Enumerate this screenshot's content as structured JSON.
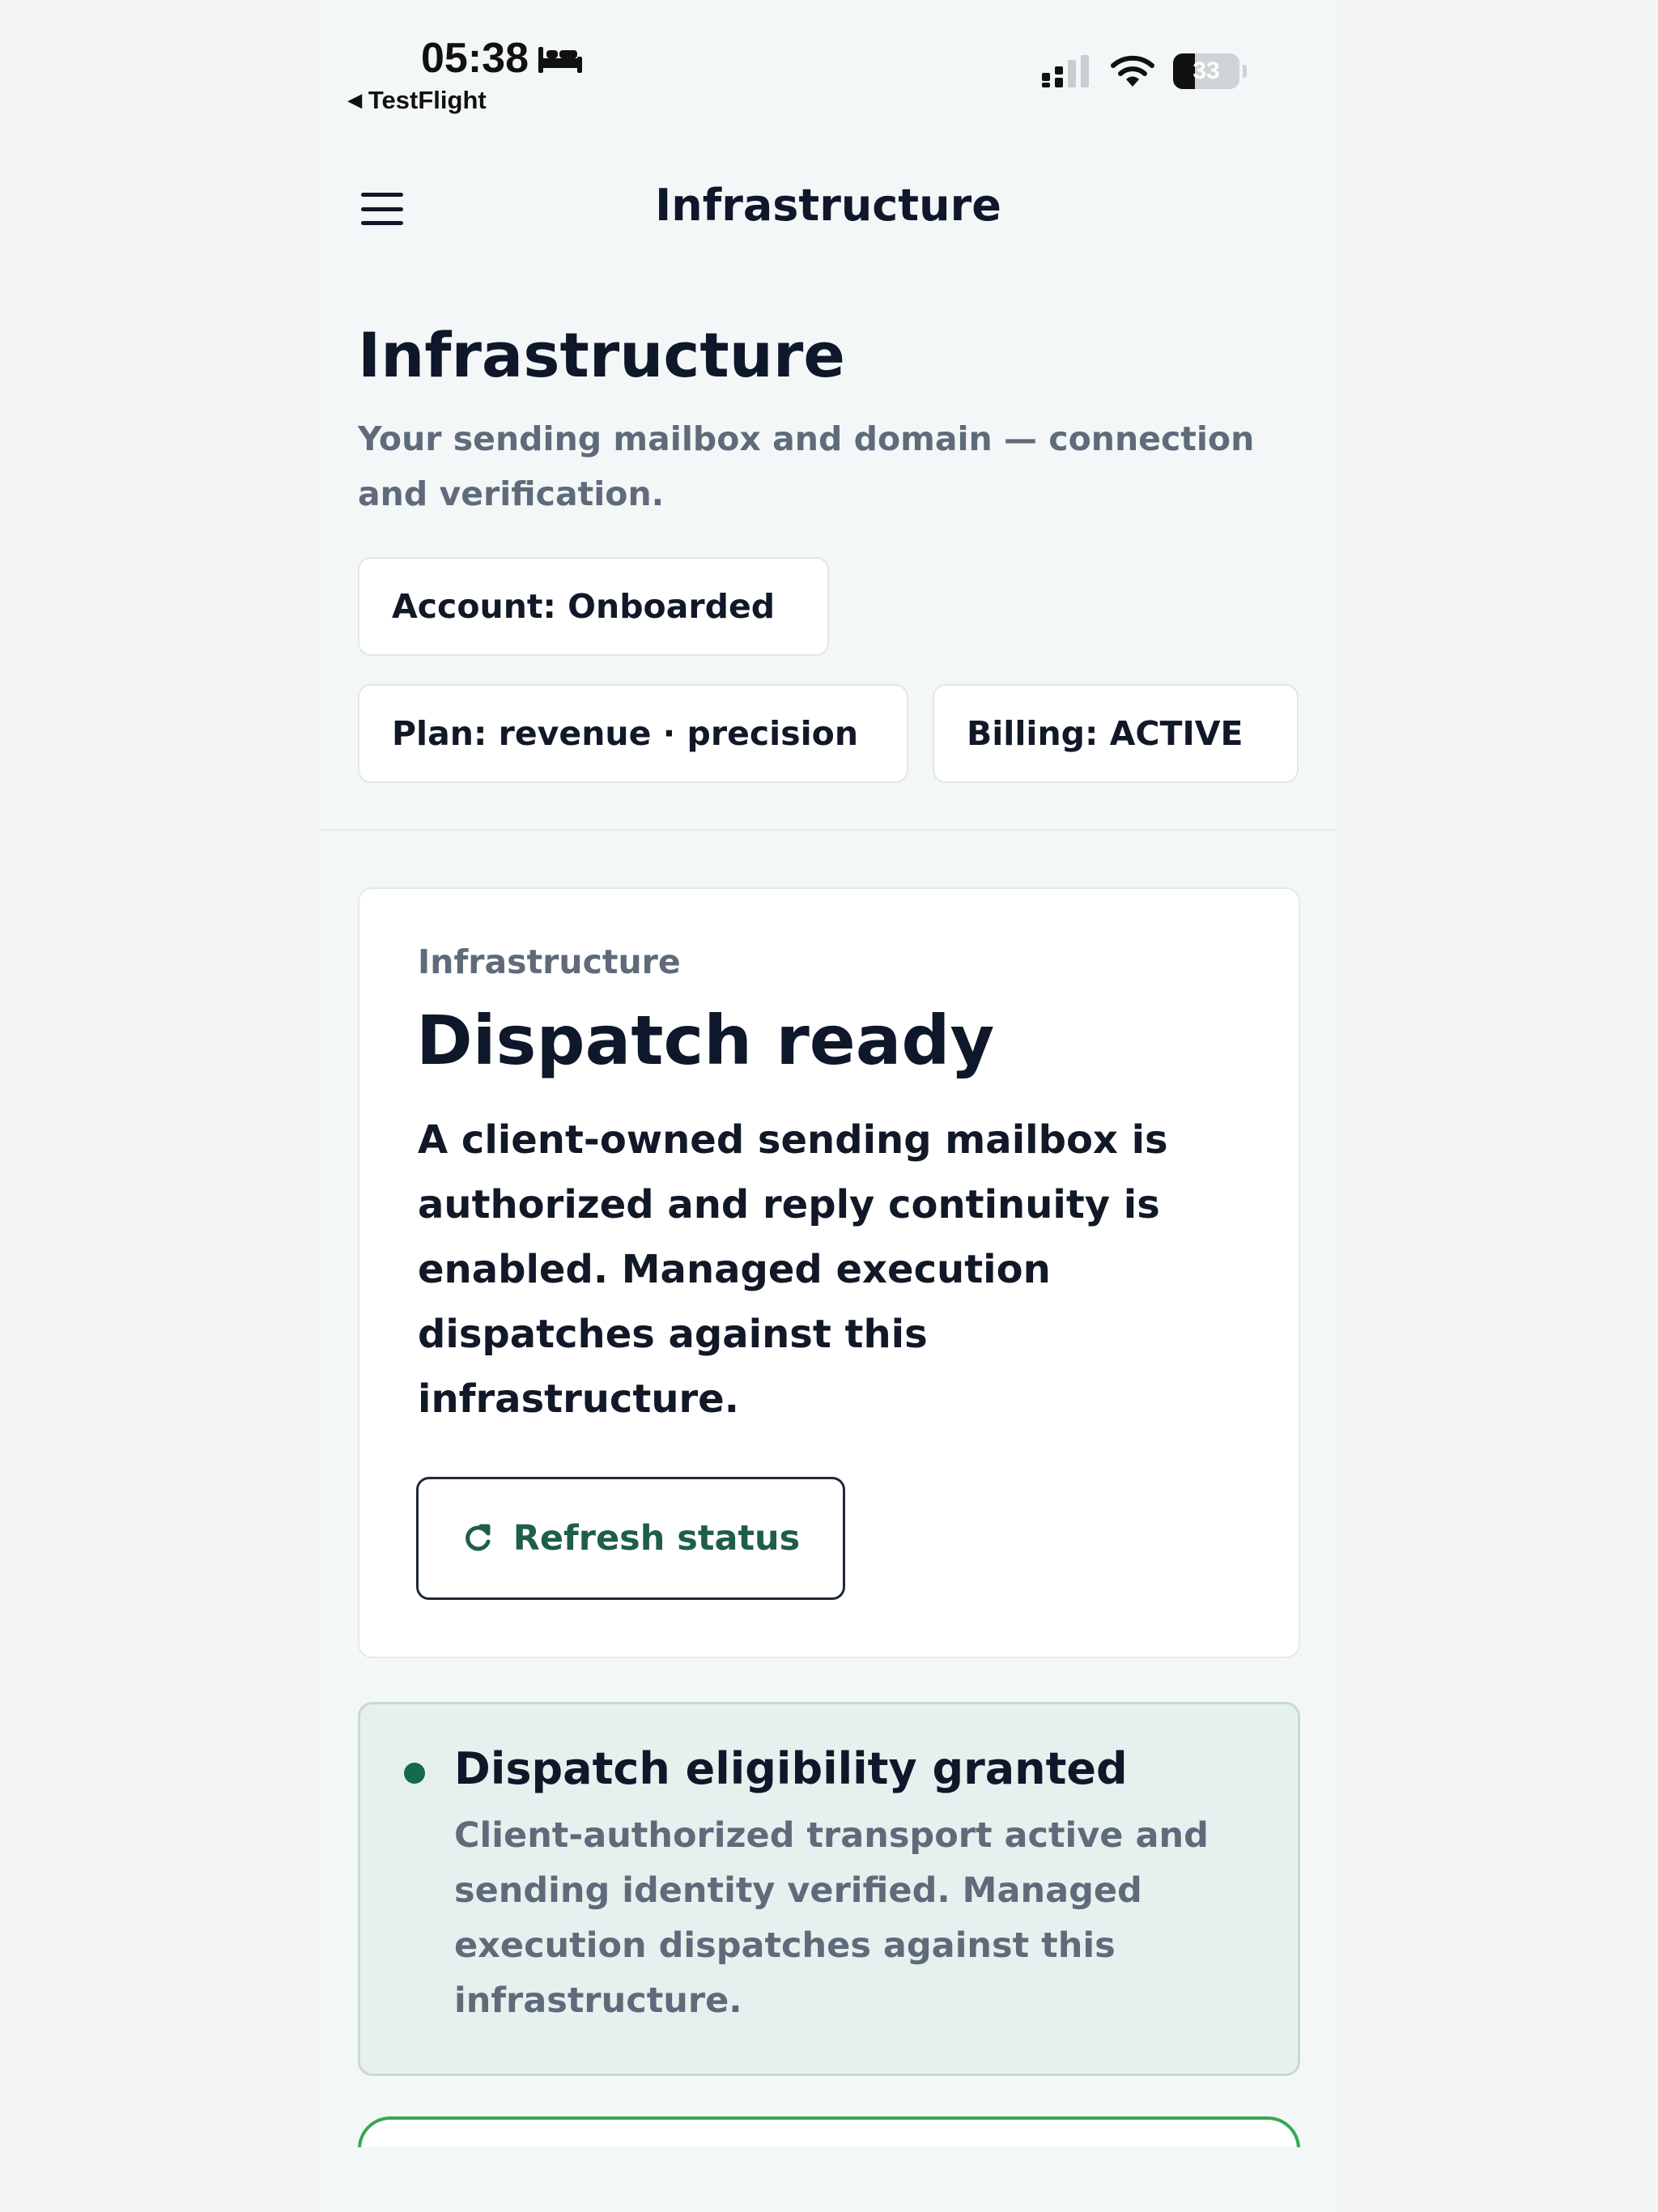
{
  "status_bar": {
    "time": "05:38",
    "back_app": "TestFlight",
    "battery_level": "33"
  },
  "header": {
    "title": "Infrastructure"
  },
  "page": {
    "title": "Infrastructure",
    "subtitle": "Your sending mailbox and domain — connection and verification."
  },
  "chips": {
    "account": "Account: Onboarded",
    "plan": "Plan: revenue · precision",
    "billing": "Billing: ACTIVE"
  },
  "status_card": {
    "eyebrow": "Infrastructure",
    "heading": "Dispatch ready",
    "body": "A client-owned sending mailbox is authorized and reply continuity is enabled. Managed execution dispatches against this infrastructure.",
    "refresh_label": "Refresh status"
  },
  "eligibility": {
    "title": "Dispatch eligibility granted",
    "body": "Client-authorized transport active and sending identity verified. Managed execution dispatches against this infrastructure."
  },
  "colors": {
    "accent_green": "#1e5e4a",
    "dot_green": "#15694f",
    "eligibility_bg": "#e6f1ef",
    "next_card_border": "#34a853"
  },
  "icons": {
    "menu": "hamburger-menu-icon",
    "refresh": "refresh-icon",
    "sleep": "bed-icon",
    "signal": "cellular-signal-icon",
    "wifi": "wifi-icon",
    "battery": "battery-icon"
  }
}
